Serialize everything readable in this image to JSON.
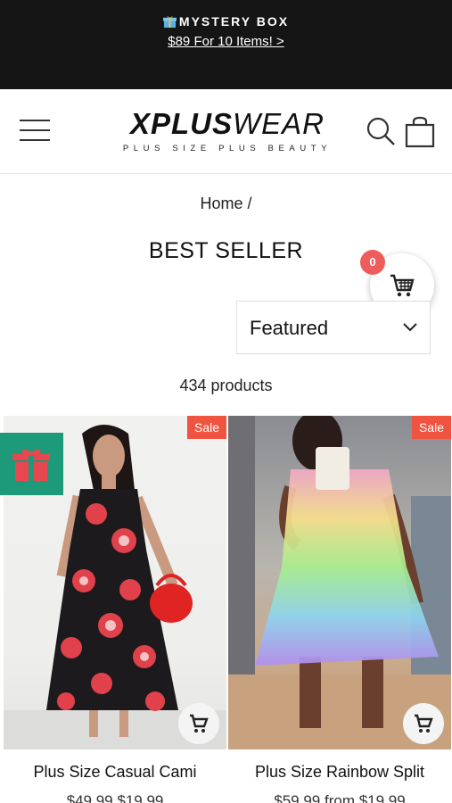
{
  "promo": {
    "title": "MYSTERY BOX",
    "link": "$89 For 10 Items! >"
  },
  "header": {
    "logo_bold": "XPLUS",
    "logo_thin": "WEAR",
    "tagline": "PLUS SIZE PLUS BEAUTY"
  },
  "breadcrumb": "Home /",
  "page_title": "BEST SELLER",
  "cart": {
    "count": "0"
  },
  "sort": {
    "selected": "Featured"
  },
  "product_count": "434 products",
  "products": [
    {
      "title": "Plus Size Casual Cami",
      "price": "$49.99  $19.99",
      "badge": "Sale"
    },
    {
      "title": "Plus Size Rainbow Split",
      "price": "$59.99  from $19.99",
      "badge": "Sale"
    }
  ],
  "colors": {
    "promo_bg": "#151515",
    "sale_badge": "#f0533f",
    "cart_badge": "#ef5c5c",
    "gift_tab": "#1c9a7a"
  },
  "icons": [
    "gift-icon",
    "menu-icon",
    "search-icon",
    "bag-icon",
    "cart-icon",
    "chevron-down-icon"
  ]
}
